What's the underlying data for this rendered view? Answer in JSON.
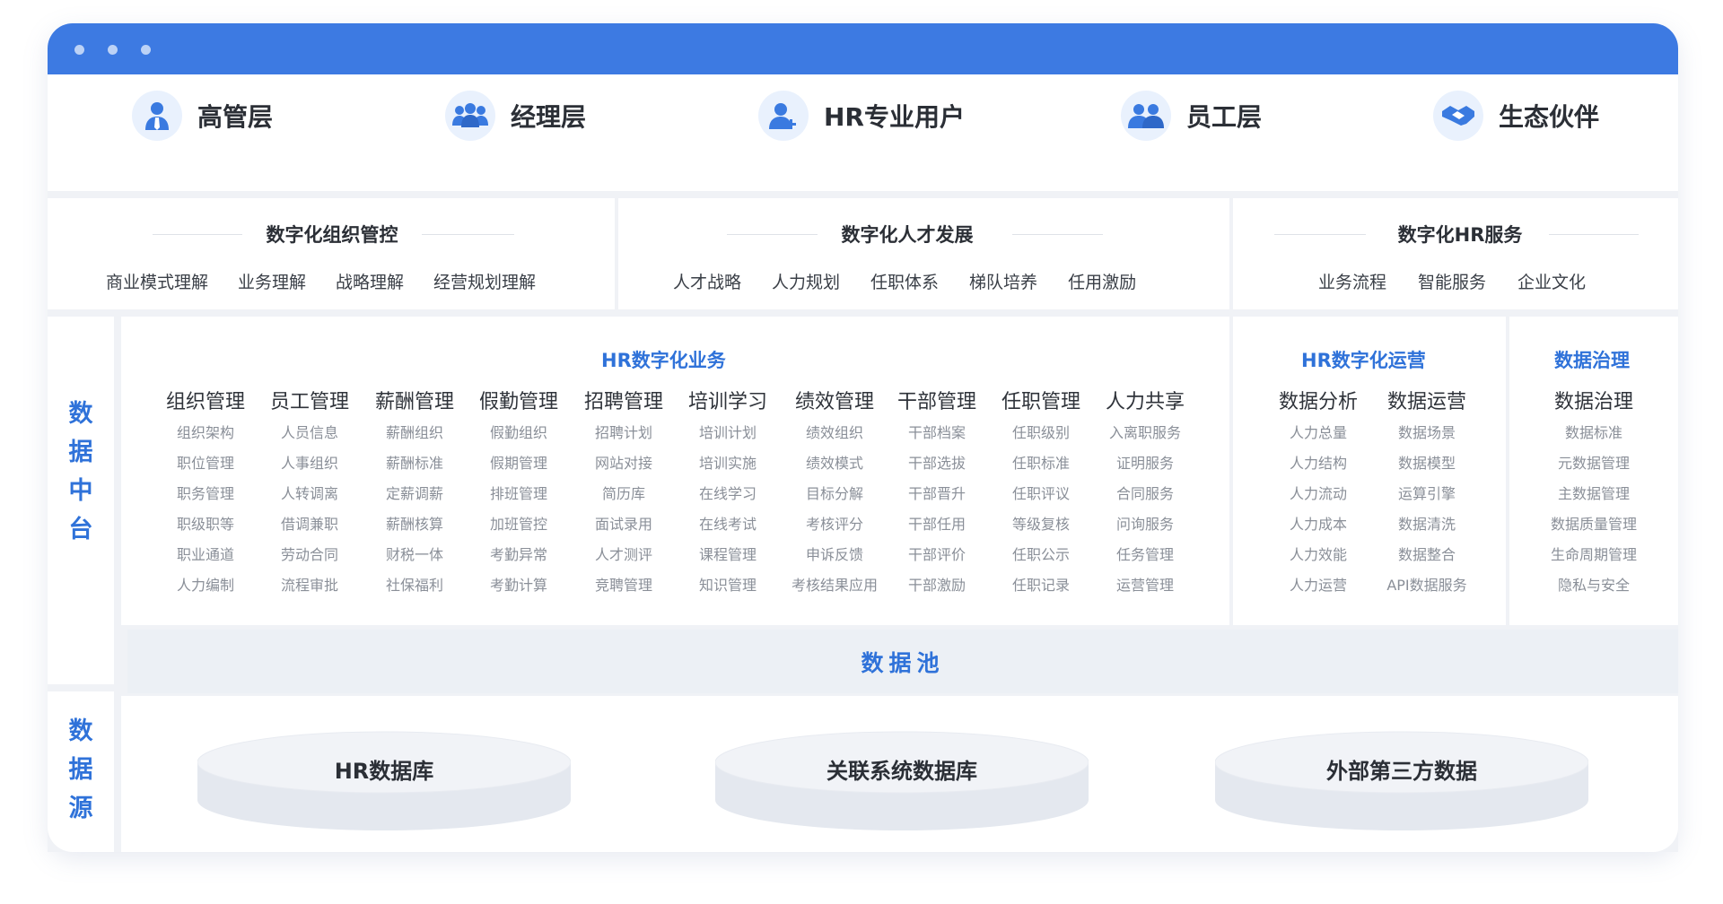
{
  "users": [
    {
      "label": "高管层",
      "icon": "executive-icon"
    },
    {
      "label": "经理层",
      "icon": "managers-group-icon"
    },
    {
      "label": "HR专业用户",
      "icon": "hr-user-add-icon"
    },
    {
      "label": "员工层",
      "icon": "employees-icon"
    },
    {
      "label": "生态伙伴",
      "icon": "handshake-icon"
    }
  ],
  "capabilities": [
    {
      "title": "数字化组织管控",
      "items": [
        "商业模式理解",
        "业务理解",
        "战略理解",
        "经营规划理解"
      ]
    },
    {
      "title": "数字化人才发展",
      "items": [
        "人才战略",
        "人力规划",
        "任职体系",
        "梯队培养",
        "任用激励"
      ]
    },
    {
      "title": "数字化HR服务",
      "items": [
        "业务流程",
        "智能服务",
        "企业文化"
      ]
    }
  ],
  "middle_label": [
    "数",
    "据",
    "中",
    "台"
  ],
  "source_label": [
    "数",
    "据",
    "源"
  ],
  "business": {
    "title": "HR数字化业务",
    "columns": [
      {
        "head": "组织管理",
        "items": [
          "组织架构",
          "职位管理",
          "职务管理",
          "职级职等",
          "职业通道",
          "人力编制"
        ]
      },
      {
        "head": "员工管理",
        "items": [
          "人员信息",
          "人事组织",
          "人转调离",
          "借调兼职",
          "劳动合同",
          "流程审批"
        ]
      },
      {
        "head": "薪酬管理",
        "items": [
          "薪酬组织",
          "薪酬标准",
          "定薪调薪",
          "薪酬核算",
          "财税一体",
          "社保福利"
        ]
      },
      {
        "head": "假勤管理",
        "items": [
          "假勤组织",
          "假期管理",
          "排班管理",
          "加班管控",
          "考勤异常",
          "考勤计算"
        ]
      },
      {
        "head": "招聘管理",
        "items": [
          "招聘计划",
          "网站对接",
          "简历库",
          "面试录用",
          "人才测评",
          "竞聘管理"
        ]
      },
      {
        "head": "培训学习",
        "items": [
          "培训计划",
          "培训实施",
          "在线学习",
          "在线考试",
          "课程管理",
          "知识管理"
        ]
      },
      {
        "head": "绩效管理",
        "items": [
          "绩效组织",
          "绩效模式",
          "目标分解",
          "考核评分",
          "申诉反馈",
          "考核结果应用"
        ]
      },
      {
        "head": "干部管理",
        "items": [
          "干部档案",
          "干部选拔",
          "干部晋升",
          "干部任用",
          "干部评价",
          "干部激励"
        ]
      },
      {
        "head": "任职管理",
        "items": [
          "任职级别",
          "任职标准",
          "任职评议",
          "等级复核",
          "任职公示",
          "任职记录"
        ]
      },
      {
        "head": "人力共享",
        "items": [
          "入离职服务",
          "证明服务",
          "合同服务",
          "问询服务",
          "任务管理",
          "运营管理"
        ]
      }
    ]
  },
  "operations": {
    "title": "HR数字化运营",
    "columns": [
      {
        "head": "数据分析",
        "items": [
          "人力总量",
          "人力结构",
          "人力流动",
          "人力成本",
          "人力效能",
          "人力运营"
        ]
      },
      {
        "head": "数据运营",
        "items": [
          "数据场景",
          "数据模型",
          "运算引擎",
          "数据清洗",
          "数据整合",
          "API数据服务"
        ]
      }
    ]
  },
  "governance": {
    "title": "数据治理",
    "columns": [
      {
        "head": "数据治理",
        "items": [
          "数据标准",
          "元数据管理",
          "主数据管理",
          "数据质量管理",
          "生命周期管理",
          "隐私与安全"
        ]
      }
    ]
  },
  "data_pool": "数据池",
  "sources": [
    "HR数据库",
    "关联系统数据库",
    "外部第三方数据"
  ],
  "colors": {
    "accent": "#2f72d9",
    "titlebar": "#3d7ae2",
    "panel_bg": "#f0f2f6"
  }
}
